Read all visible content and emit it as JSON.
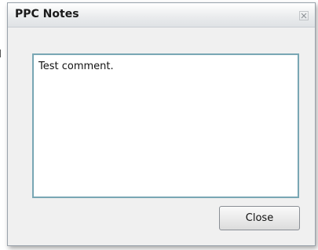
{
  "dialog": {
    "title": "PPC Notes",
    "close_icon": "close-icon",
    "comment_text": "Test comment.",
    "close_button_label": "Close"
  },
  "colors": {
    "textarea_border": "#79a7b4",
    "dialog_background": "#f0f0f0"
  }
}
